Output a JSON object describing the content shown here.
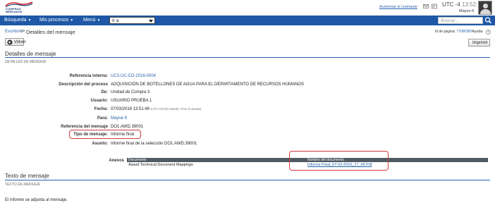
{
  "header": {
    "logo_line1": "COMPRAS",
    "logo_line2": "MERCADOS",
    "contrast_link": "Aumentar el contraste",
    "timezone": "UTC -4",
    "time": "13:52:13",
    "user": "Mayne ft"
  },
  "nav": {
    "items": [
      {
        "label": "Búsqueda"
      },
      {
        "label": "Mis procesos"
      },
      {
        "label": "Menú"
      }
    ],
    "goto_value": "Ir a",
    "search_placeholder": "Buscar..."
  },
  "breadcrumb": {
    "link": "Escritorio",
    "separator": "->",
    "title": "Detalles del mensaje"
  },
  "page_info": {
    "id_label": "Id de página:",
    "id_value": "77000387",
    "help": "Ayuda"
  },
  "buttons": {
    "back": "Volver",
    "print": "Imprimir"
  },
  "details": {
    "section_title": "Detalles de mensaje",
    "section_sub": "DETALLES DE MENSAJE",
    "fields": [
      {
        "label": "Referencia interna:",
        "value": "UC3-UC-CD-2016-0004",
        "link": true
      },
      {
        "label": "Descripción del proceso",
        "value": "ADQUISICIÓN DE BOTELLONES DE AGUA PARA EL DEPARTAMENTO DE RECURSOS HUMANOS",
        "link": false
      },
      {
        "label": "De:",
        "value": "Unidad de Compra 3",
        "link": false
      },
      {
        "label": "Usuario:",
        "value": "USUARIO PRUEBA 1",
        "link": false
      },
      {
        "label": "Fecha:",
        "value": "07/03/2016 13:51:46",
        "note": "(UTC-04:00) Atlantic Time (Canada)",
        "link": false
      },
      {
        "label": "Para:",
        "value": "Mayne ft",
        "link": true
      },
      {
        "label": "Referencia del mensaje",
        "value": "DO1.AWD.39001",
        "link": false
      },
      {
        "label": "Tipo de mensaje:",
        "value": "Informe final",
        "link": false
      },
      {
        "label": "Asunto:",
        "value": "Informe final de la selección DO1.AWD.39001",
        "link": false
      }
    ],
    "attachments_label": "Anexos",
    "attachments": {
      "headers": [
        "Documento",
        "Nombre del documento"
      ],
      "rows": [
        {
          "document": "Award Technical Document Mappings",
          "name": "Informe Final_07-03-2016_17_49.Pdf"
        }
      ]
    }
  },
  "message": {
    "section_title": "Texto de mensaje",
    "section_sub": "TEXTO DE MENSAJE",
    "body": "El informe se adjunta al mensaje."
  },
  "colors": {
    "nav_bg": "#1e58a6",
    "link": "#2563a8",
    "highlight": "#d03a3a",
    "table_header": "#505a63"
  }
}
